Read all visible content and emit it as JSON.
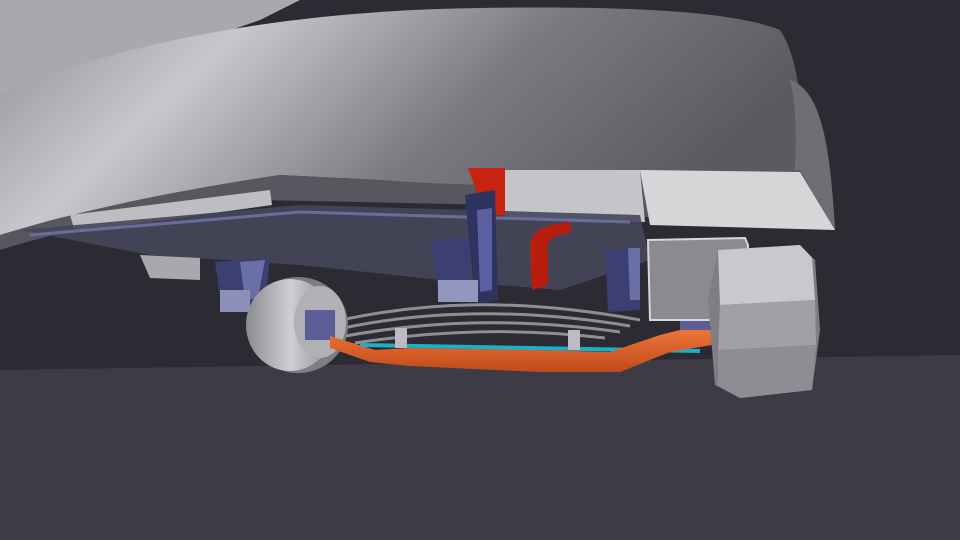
{
  "scene": {
    "description_visible_text": "",
    "colors": {
      "background_upper": "#2d2c33",
      "background_floor": "#3d3c46",
      "body_light": "#c9c9cc",
      "body_mid": "#9a9aa0",
      "body_dark": "#55555c",
      "frame_navy": "#3a3e6e",
      "frame_navy_light": "#6a6fa8",
      "axle_orange": "#e8632a",
      "axle_orange_dark": "#b8441b",
      "steering_red": "#c8220f",
      "tie_rod_cyan": "#1ab0c8",
      "wheel_light": "#c4c4c8",
      "wheel_dark": "#7a7a80"
    },
    "objects": [
      "vehicle-body-underside",
      "chassis-frame",
      "leaf-spring-left",
      "leaf-spring-right",
      "front-axle-beam",
      "tie-rod",
      "steering-arm",
      "left-wheel",
      "right-wheel"
    ]
  }
}
